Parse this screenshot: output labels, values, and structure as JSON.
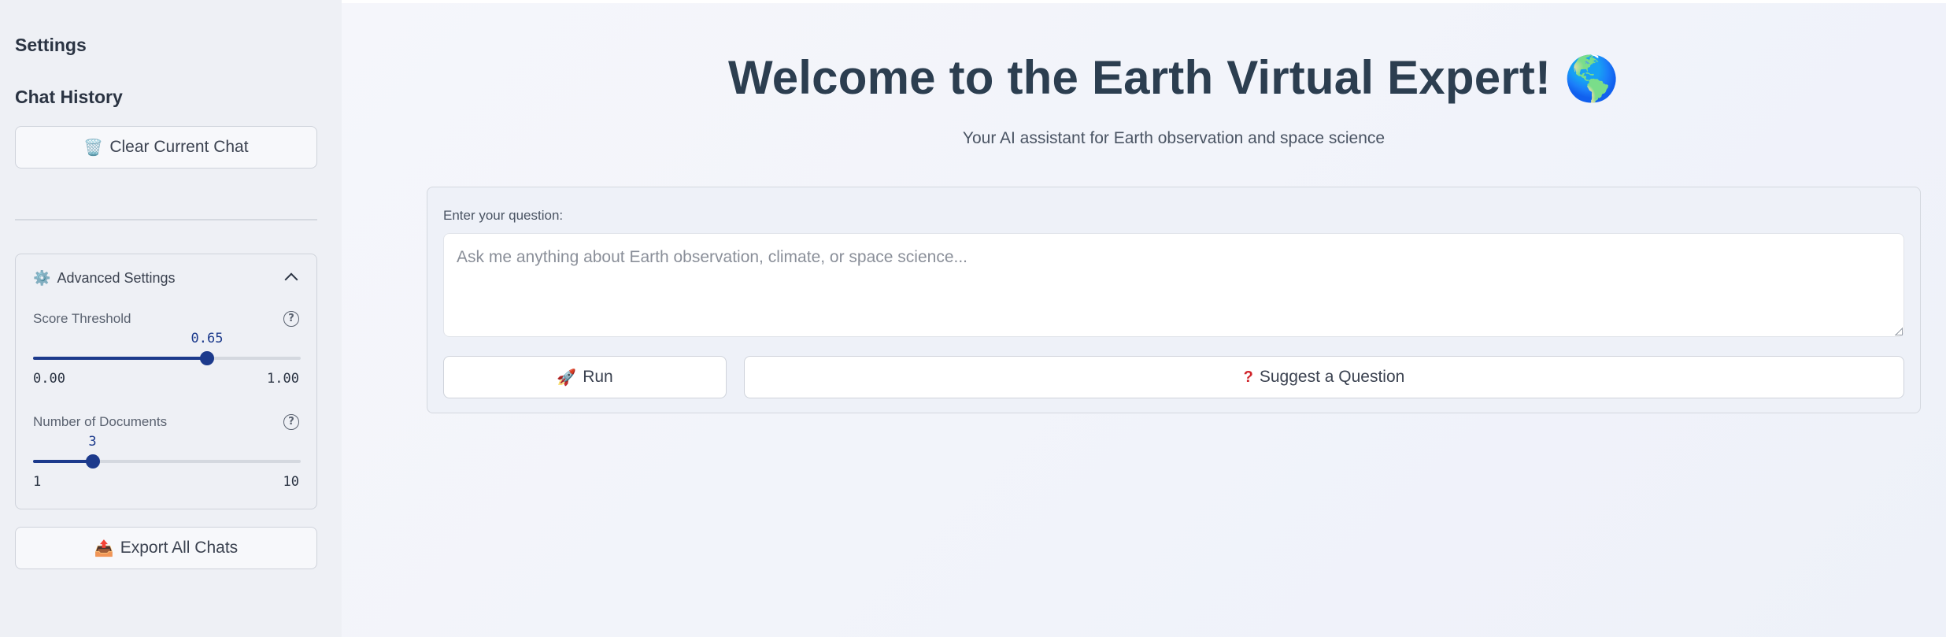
{
  "sidebar": {
    "title": "Settings",
    "chat_history_title": "Chat History",
    "clear_button": {
      "icon": "wastebasket-icon",
      "glyph": "🗑️",
      "label": "Clear Current Chat"
    },
    "advanced": {
      "icon": "gear-icon",
      "glyph": "⚙️",
      "title": "Advanced Settings",
      "expanded": true,
      "score_threshold": {
        "label": "Score Threshold",
        "value": "0.65",
        "fraction": 0.65,
        "min": "0.00",
        "max": "1.00",
        "help": "?"
      },
      "num_documents": {
        "label": "Number of Documents",
        "value": "3",
        "fraction": 0.2222,
        "min": "1",
        "max": "10",
        "help": "?"
      }
    },
    "export_button": {
      "icon": "outbox-tray-icon",
      "glyph": "📤",
      "label": "Export All Chats"
    }
  },
  "main": {
    "title": "Welcome to the Earth Virtual Expert!",
    "title_glyph": "🌎",
    "subtitle": "Your AI assistant for Earth observation and space science",
    "form": {
      "input_label": "Enter your question:",
      "input_placeholder": "Ask me anything about Earth observation, climate, or space science...",
      "input_value": "",
      "run_button": {
        "icon": "rocket-icon",
        "glyph": "🚀",
        "label": "Run"
      },
      "suggest_button": {
        "icon": "question-mark-icon",
        "glyph": "❓",
        "label": "Suggest a Question"
      }
    }
  },
  "colors": {
    "accent": "#1c3a8c",
    "title": "#2c3e50",
    "sidebar_bg": "#eef0f5"
  }
}
